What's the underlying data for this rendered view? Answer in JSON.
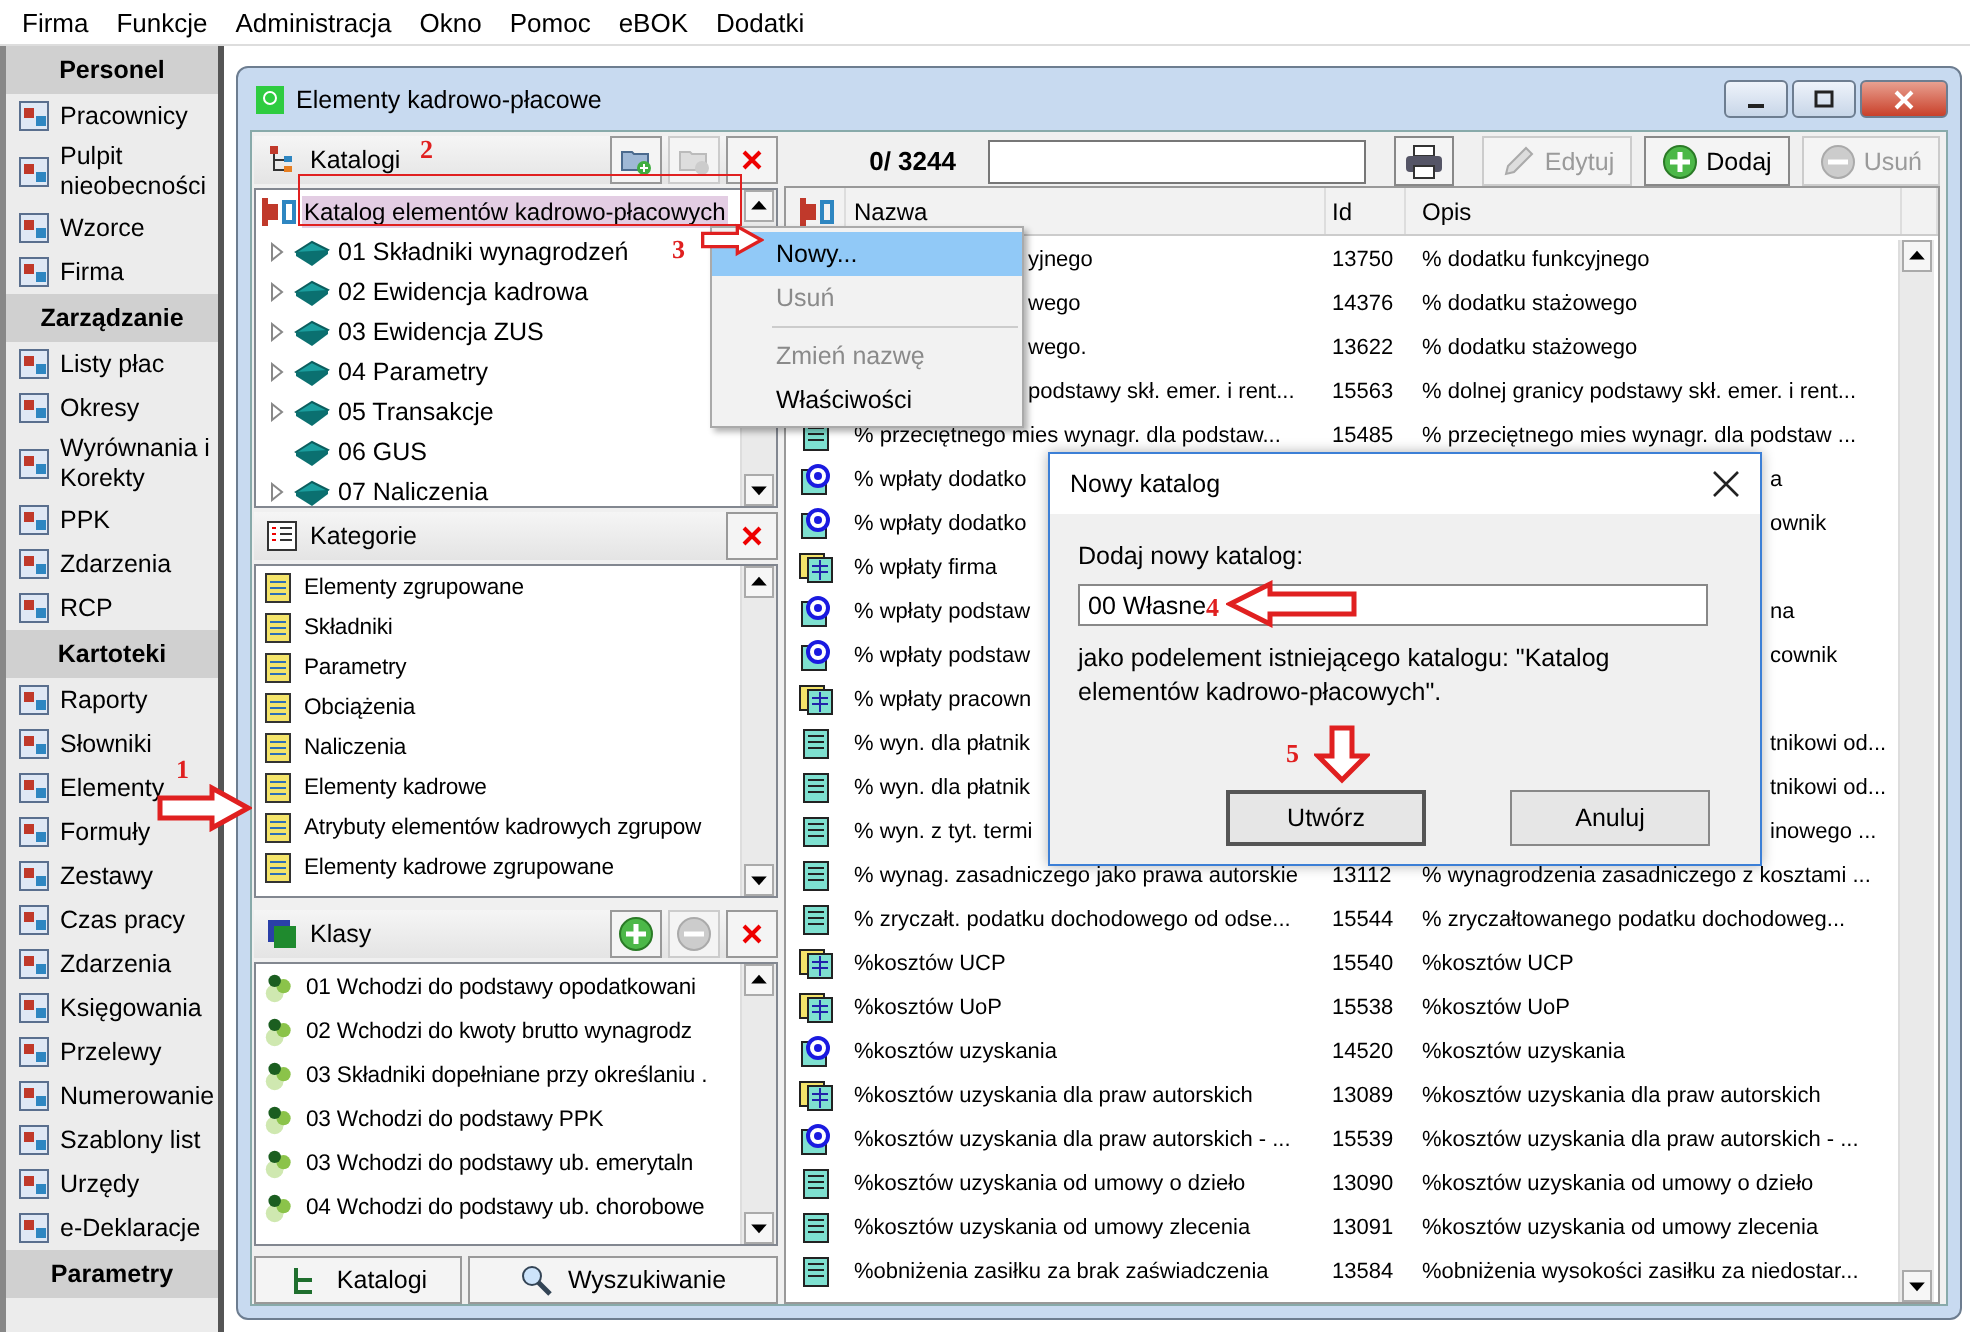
{
  "menubar": [
    "Firma",
    "Funkcje",
    "Administracja",
    "Okno",
    "Pomoc",
    "eBOK",
    "Dodatki"
  ],
  "sidebar": {
    "groups": [
      {
        "title": "Personel",
        "items": [
          "Pracownicy",
          "Pulpit nieobecności",
          "Wzorce",
          "Firma"
        ]
      },
      {
        "title": "Zarządzanie",
        "items": [
          "Listy płac",
          "Okresy",
          "Wyrównania i Korekty",
          "PPK",
          "Zdarzenia",
          "RCP"
        ]
      },
      {
        "title": "Kartoteki",
        "items": [
          "Raporty",
          "Słowniki",
          "Elementy",
          "Formuły",
          "Zestawy",
          "Czas pracy",
          "Zdarzenia",
          "Księgowania",
          "Przelewy",
          "Numerowanie",
          "Szablony list",
          "Urzędy",
          "e-Deklaracje"
        ]
      },
      {
        "title": "Parametry"
      }
    ]
  },
  "window": {
    "title": "Elementy kadrowo-płacowe"
  },
  "katalogi": {
    "title": "Katalogi",
    "tree": [
      {
        "label": "Katalog elementów kadrowo-płacowych",
        "selected": true,
        "children": [
          {
            "label": "01 Składniki wynagrodzeń",
            "selected": false,
            "has_children": true
          },
          {
            "label": "02 Ewidencja kadrowa",
            "selected": false,
            "has_children": true
          },
          {
            "label": "03 Ewidencja ZUS",
            "selected": false,
            "has_children": true
          },
          {
            "label": "04 Parametry",
            "selected": false,
            "has_children": true
          },
          {
            "label": "05 Transakcje",
            "selected": false,
            "has_children": true
          },
          {
            "label": "06 GUS",
            "selected": false,
            "has_children": false
          },
          {
            "label": "07 Naliczenia",
            "selected": false,
            "has_children": true
          }
        ]
      }
    ]
  },
  "kategorie": {
    "title": "Kategorie",
    "items": [
      "Elementy zgrupowane",
      "Składniki",
      "Parametry",
      "Obciążenia",
      "Naliczenia",
      "Elementy kadrowe",
      "Atrybuty elementów kadrowych zgrupow",
      "Elementy kadrowe zgrupowane"
    ]
  },
  "klasy": {
    "title": "Klasy",
    "items": [
      "01 Wchodzi do podstawy opodatkowani",
      "02 Wchodzi do kwoty brutto wynagrodz",
      "03 Składniki dopełniane przy określaniu .",
      "03 Wchodzi do podstawy PPK",
      "03 Wchodzi do podstawy ub. emerytaln",
      "04 Wchodzi do podstawy ub. chorobowe"
    ]
  },
  "bottom_buttons": [
    "Katalogi",
    "Wyszukiwanie"
  ],
  "toolbar": {
    "counter": "0/ 3244",
    "buttons": [
      {
        "label": "Edytuj",
        "disabled": true,
        "kind": "edit"
      },
      {
        "label": "Dodaj",
        "disabled": false,
        "kind": "add"
      },
      {
        "label": "Usuń",
        "disabled": true,
        "kind": "remove"
      }
    ]
  },
  "table": {
    "columns": [
      "Nazwa",
      "Id",
      "Opis"
    ],
    "rows": [
      {
        "kind": "covered",
        "name": "yjnego",
        "id": "13750",
        "opis": "% dodatku funkcyjnego"
      },
      {
        "kind": "covered",
        "name": "wego",
        "id": "14376",
        "opis": "% dodatku stażowego"
      },
      {
        "kind": "covered",
        "name": "wego.",
        "id": "13622",
        "opis": "% dodatku stażowego"
      },
      {
        "kind": "covered",
        "name": "podstawy skł. emer. i rent...",
        "id": "15563",
        "opis": "% dolnej granicy podstawy skł. emer. i rent..."
      },
      {
        "kind": "sheet",
        "name": "% przeciętnego mies wynagr. dla podstaw...",
        "id": "15485",
        "opis": "% przeciętnego mies wynagr. dla podstaw ..."
      },
      {
        "kind": "target",
        "name": "% wpłaty dodatko",
        "opis": "a"
      },
      {
        "kind": "target",
        "name": "% wpłaty dodatko",
        "opis": "ownik"
      },
      {
        "kind": "stack",
        "name": "% wpłaty firma"
      },
      {
        "kind": "target",
        "name": "% wpłaty podstaw",
        "opis": "na"
      },
      {
        "kind": "target",
        "name": "% wpłaty podstaw",
        "opis": "cownik"
      },
      {
        "kind": "stack",
        "name": "% wpłaty pracown"
      },
      {
        "kind": "sheet",
        "name": "% wyn. dla płatnik",
        "opis": "tnikowi od..."
      },
      {
        "kind": "sheet",
        "name": "% wyn. dla płatnik",
        "opis": "tnikowi od..."
      },
      {
        "kind": "sheet",
        "name": "% wyn. z tyt. termi",
        "opis": "inowego ..."
      },
      {
        "kind": "sheet",
        "name": "% wynag. zasadniczego jako prawa autorskie",
        "id": "13112",
        "opis": "% wynagrodzenia zasadniczego z kosztami ..."
      },
      {
        "kind": "sheet",
        "name": "% zryczałt. podatku dochodowego od odse...",
        "id": "15544",
        "opis": "% zryczałtowanego podatku dochodoweg..."
      },
      {
        "kind": "stack",
        "name": "%kosztów UCP",
        "id": "15540",
        "opis": "%kosztów UCP"
      },
      {
        "kind": "stack",
        "name": "%kosztów UoP",
        "id": "15538",
        "opis": "%kosztów UoP"
      },
      {
        "kind": "target",
        "name": "%kosztów uzyskania",
        "id": "14520",
        "opis": "%kosztów uzyskania"
      },
      {
        "kind": "stack",
        "name": "%kosztów uzyskania dla praw autorskich",
        "id": "13089",
        "opis": "%kosztów uzyskania dla praw autorskich"
      },
      {
        "kind": "target",
        "name": "%kosztów uzyskania dla praw autorskich - ...",
        "id": "15539",
        "opis": "%kosztów uzyskania dla praw autorskich - ..."
      },
      {
        "kind": "sheet",
        "name": "%kosztów uzyskania od umowy o dzieło",
        "id": "13090",
        "opis": "%kosztów uzyskania od umowy o dzieło"
      },
      {
        "kind": "sheet",
        "name": "%kosztów uzyskania od umowy zlecenia",
        "id": "13091",
        "opis": "%kosztów uzyskania od umowy zlecenia"
      },
      {
        "kind": "sheet",
        "name": "%obniżenia zasiłku za brak zaświadczenia",
        "id": "13584",
        "opis": "%obniżenia wysokości zasiłku za niedostar..."
      }
    ]
  },
  "context_menu": [
    {
      "label": "Nowy...",
      "selected": true,
      "disabled": false
    },
    {
      "label": "Usuń",
      "selected": false,
      "disabled": true
    },
    {
      "kind": "separator"
    },
    {
      "label": "Zmień nazwę",
      "selected": false,
      "disabled": true
    },
    {
      "label": "Właściwości",
      "selected": false,
      "disabled": false
    }
  ],
  "dialog": {
    "title": "Nowy katalog",
    "label": "Dodaj nowy katalog:",
    "value": "00 Własne",
    "note": "jako podelement istniejącego katalogu: \"Katalog elementów kadrowo-płacowych\".",
    "buttons": [
      "Utwórz",
      "Anuluj"
    ]
  },
  "annotations": [
    {
      "label": "1",
      "kind": "right"
    },
    {
      "label": "2",
      "kind": "none"
    },
    {
      "label": "3",
      "kind": "right"
    },
    {
      "label": "4",
      "kind": "left"
    },
    {
      "label": "5",
      "kind": "down"
    }
  ]
}
